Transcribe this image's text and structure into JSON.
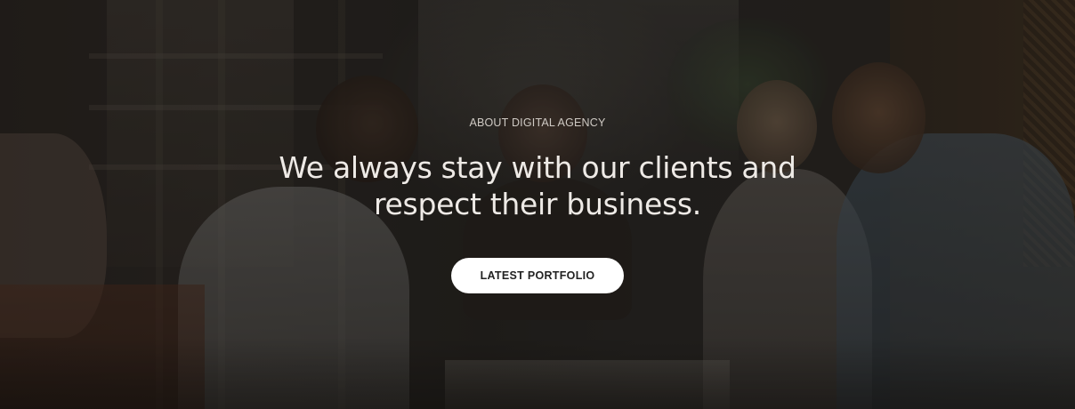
{
  "hero": {
    "eyebrow": "ABOUT DIGITAL AGENCY",
    "headline_line1": "We always stay with our clients and",
    "headline_line2": "respect their business.",
    "cta_label": "LATEST PORTFOLIO",
    "background_description": "team-meeting-photo",
    "colors": {
      "overlay": "#141210",
      "headline_text": "#eeeae6",
      "eyebrow_text": "#cfcac4",
      "button_bg": "#ffffff",
      "button_text": "#222222"
    }
  }
}
